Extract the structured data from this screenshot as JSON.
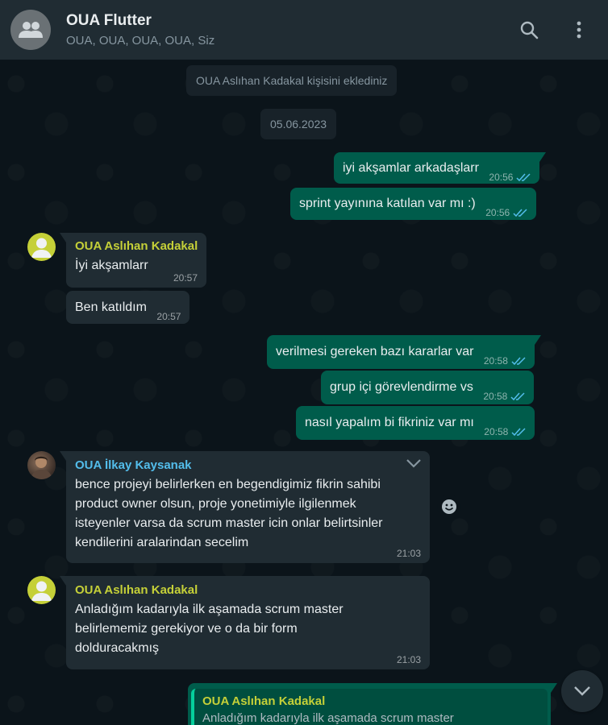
{
  "header": {
    "title": "OUA Flutter",
    "subtitle": "OUA, OUA, OUA, OUA, Siz"
  },
  "system": {
    "added": "OUA Aslıhan Kadakal kişisini eklediniz",
    "date": "05.06.2023"
  },
  "messages": [
    {
      "text": "iyi akşamlar arkadaşlarr",
      "time": "20:56"
    },
    {
      "text": "sprint yayınına katılan var mı :)",
      "time": "20:56"
    },
    {
      "sender": "OUA Aslıhan Kadakal",
      "text": "İyi akşamlarr",
      "time": "20:57"
    },
    {
      "text": "Ben katıldım",
      "time": "20:57"
    },
    {
      "text": "verilmesi gereken bazı kararlar var",
      "time": "20:58"
    },
    {
      "text": "grup içi görevlendirme vs",
      "time": "20:58"
    },
    {
      "text": "nasıl yapalım bi fikriniz var mı",
      "time": "20:58"
    },
    {
      "sender": "OUA İlkay Kaysanak",
      "lines": [
        "bence projeyi belirlerken en begendigimiz fikrin sahibi",
        "product owner olsun, proje yonetimiyle ilgilenmek",
        "isteyenler varsa da scrum master icin onlar belirtsinler",
        "kendilerini aralarindan secelim"
      ],
      "time": "21:03"
    },
    {
      "sender": "OUA Aslıhan Kadakal",
      "lines": [
        "Anladığım kadarıyla ilk aşamada scrum master",
        "belirlememiz gerekiyor  ve o da bir form",
        "dolduracakmış"
      ],
      "time": "21:03"
    },
    {
      "quote_sender": "OUA Aslıhan Kadakal",
      "quote_text": "Anladığım kadarıyla ilk aşamada scrum master"
    }
  ],
  "colors": {
    "outgoing": "#005c4b",
    "incoming": "#202c33",
    "sender_aslihan": "#c5d038",
    "sender_ilkay": "#53bdeb",
    "read_ticks": "#53bdeb"
  }
}
